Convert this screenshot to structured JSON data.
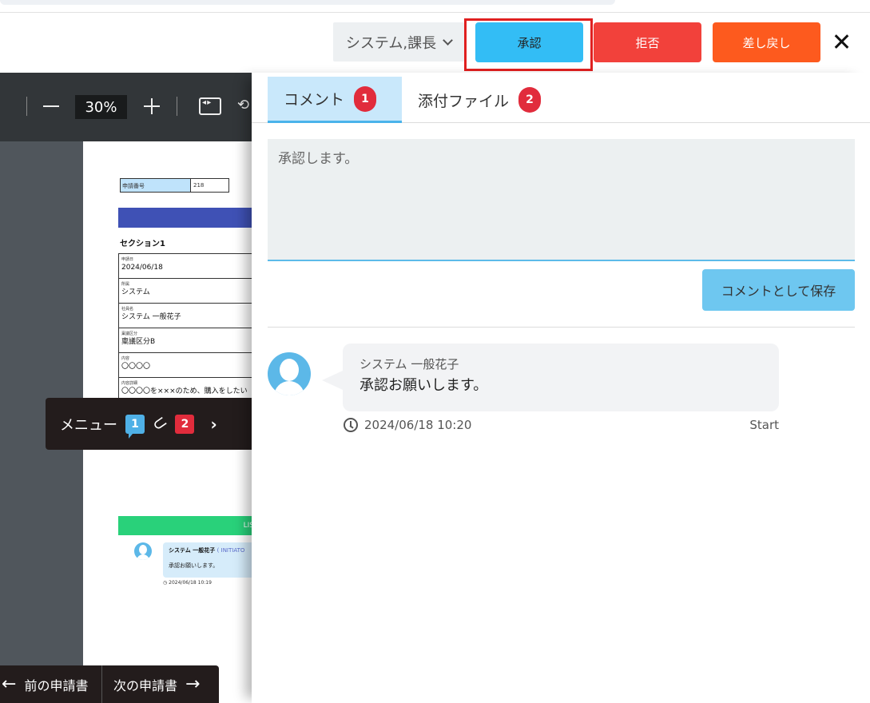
{
  "header": {
    "approver_label": "システム,課長",
    "approve_label": "承認",
    "reject_label": "拒否",
    "return_label": "差し戻し"
  },
  "viewer": {
    "zoom": "30%",
    "doc": {
      "id_label": "申請番号",
      "id_value": "218",
      "section": "セクション1",
      "fields": [
        {
          "label": "申請日",
          "value": "2024/06/18"
        },
        {
          "label": "所属",
          "value": "システム"
        },
        {
          "label": "社員名",
          "value": "システム 一般花子"
        },
        {
          "label": "稟議区分",
          "value": "稟議区分B"
        },
        {
          "label": "内容",
          "value": "〇〇〇〇"
        },
        {
          "label": "内容詳細",
          "value": "〇〇〇〇を×××のため、購入をしたい"
        }
      ],
      "list_band": "LIS",
      "mini_comment": {
        "name": "システム 一般花子",
        "role": "( INITIATO",
        "text": "承認お願いします。",
        "time": "2024/06/18 10:19"
      }
    },
    "menu": {
      "label": "メニュー",
      "comment_count": "1",
      "attachment_count": "2"
    },
    "nav": {
      "prev_label": "前の申請書",
      "next_label": "次の申請書"
    }
  },
  "panel": {
    "tabs": [
      {
        "label": "コメント",
        "count": "1"
      },
      {
        "label": "添付ファイル",
        "count": "2"
      }
    ],
    "comment_input": "承認します。",
    "save_label": "コメントとして保存",
    "comments": [
      {
        "author": "システム 一般花子",
        "text": "承認お願いします。",
        "time": "2024/06/18 10:20",
        "status": "Start"
      }
    ]
  },
  "colors": {
    "approve": "#33bdf5",
    "reject": "#f2413b",
    "return": "#fd5a1e",
    "highlight": "#e02020",
    "badge": "#e12c3c"
  }
}
